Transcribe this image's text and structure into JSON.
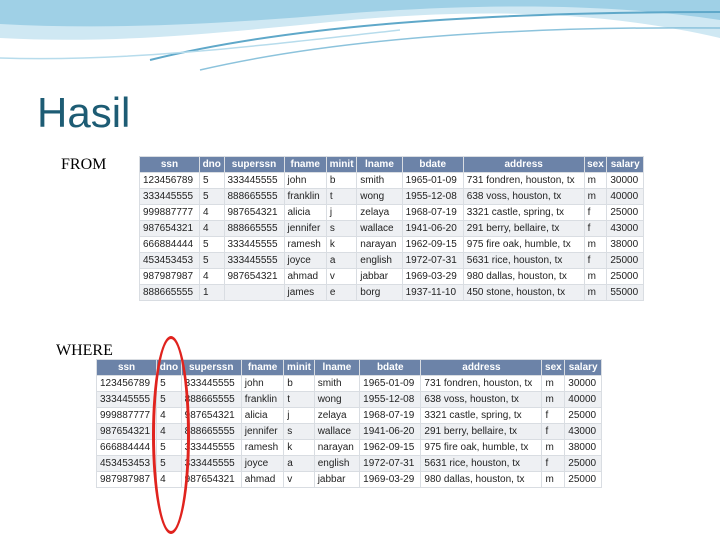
{
  "slide": {
    "title": "Hasil"
  },
  "labels": {
    "from": "FROM",
    "where": "WHERE"
  },
  "colors": {
    "title": "#1d5c74",
    "table_header": "#6c83a8",
    "oval": "#e0231e",
    "wave_light": "#cfe8f3",
    "wave_dark": "#5fa8c9"
  },
  "from_table": {
    "columns": [
      "ssn",
      "dno",
      "superssn",
      "fname",
      "minit",
      "lname",
      "bdate",
      "address",
      "sex",
      "salary"
    ],
    "rows": [
      [
        "123456789",
        "5",
        "333445555",
        "john",
        "b",
        "smith",
        "1965-01-09",
        "731 fondren, houston, tx",
        "m",
        "30000"
      ],
      [
        "333445555",
        "5",
        "888665555",
        "franklin",
        "t",
        "wong",
        "1955-12-08",
        "638 voss, houston, tx",
        "m",
        "40000"
      ],
      [
        "999887777",
        "4",
        "987654321",
        "alicia",
        "j",
        "zelaya",
        "1968-07-19",
        "3321 castle, spring, tx",
        "f",
        "25000"
      ],
      [
        "987654321",
        "4",
        "888665555",
        "jennifer",
        "s",
        "wallace",
        "1941-06-20",
        "291 berry, bellaire, tx",
        "f",
        "43000"
      ],
      [
        "666884444",
        "5",
        "333445555",
        "ramesh",
        "k",
        "narayan",
        "1962-09-15",
        "975 fire oak, humble, tx",
        "m",
        "38000"
      ],
      [
        "453453453",
        "5",
        "333445555",
        "joyce",
        "a",
        "english",
        "1972-07-31",
        "5631 rice, houston, tx",
        "f",
        "25000"
      ],
      [
        "987987987",
        "4",
        "987654321",
        "ahmad",
        "v",
        "jabbar",
        "1969-03-29",
        "980 dallas, houston, tx",
        "m",
        "25000"
      ],
      [
        "888665555",
        "1",
        "",
        "james",
        "e",
        "borg",
        "1937-11-10",
        "450 stone, houston, tx",
        "m",
        "55000"
      ]
    ]
  },
  "where_table": {
    "columns": [
      "ssn",
      "dno",
      "superssn",
      "fname",
      "minit",
      "lname",
      "bdate",
      "address",
      "sex",
      "salary"
    ],
    "rows": [
      [
        "123456789",
        "5",
        "333445555",
        "john",
        "b",
        "smith",
        "1965-01-09",
        "731 fondren, houston, tx",
        "m",
        "30000"
      ],
      [
        "333445555",
        "5",
        "888665555",
        "franklin",
        "t",
        "wong",
        "1955-12-08",
        "638 voss, houston, tx",
        "m",
        "40000"
      ],
      [
        "999887777",
        "4",
        "987654321",
        "alicia",
        "j",
        "zelaya",
        "1968-07-19",
        "3321 castle, spring, tx",
        "f",
        "25000"
      ],
      [
        "987654321",
        "4",
        "888665555",
        "jennifer",
        "s",
        "wallace",
        "1941-06-20",
        "291 berry, bellaire, tx",
        "f",
        "43000"
      ],
      [
        "666884444",
        "5",
        "333445555",
        "ramesh",
        "k",
        "narayan",
        "1962-09-15",
        "975 fire oak, humble, tx",
        "m",
        "38000"
      ],
      [
        "453453453",
        "5",
        "333445555",
        "joyce",
        "a",
        "english",
        "1972-07-31",
        "5631 rice, houston, tx",
        "f",
        "25000"
      ],
      [
        "987987987",
        "4",
        "987654321",
        "ahmad",
        "v",
        "jabbar",
        "1969-03-29",
        "980 dallas, houston, tx",
        "m",
        "25000"
      ]
    ]
  }
}
